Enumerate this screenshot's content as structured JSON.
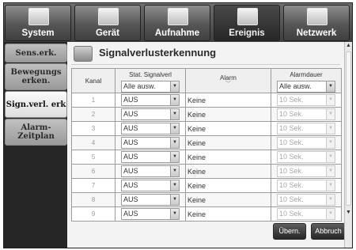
{
  "nav": {
    "tabs": [
      {
        "label": "System",
        "icon": "monitor-icon",
        "active": false
      },
      {
        "label": "Gerät",
        "icon": "camera-icon",
        "active": false
      },
      {
        "label": "Aufnahme",
        "icon": "rec-icon",
        "active": false
      },
      {
        "label": "Ereignis",
        "icon": "event-icon",
        "active": true
      },
      {
        "label": "Netzwerk",
        "icon": "network-icon",
        "active": false
      }
    ]
  },
  "sidebar": {
    "items": [
      {
        "label": "Sens.erk.",
        "active": false
      },
      {
        "label": "Bewegungs erken.",
        "active": false
      },
      {
        "label": "Sign.verl. erk",
        "active": true
      },
      {
        "label": "Alarm-Zeitplan",
        "active": false
      }
    ]
  },
  "page": {
    "title": "Signalverlusterkennung"
  },
  "table": {
    "headers": {
      "kanal": "Kanal",
      "status": "Stat. Signalverl",
      "alarm": "Alarm",
      "duration": "Alarmdauer"
    },
    "all_select_status": "Alle ausw.",
    "all_select_duration": "Alle ausw.",
    "rows": [
      {
        "kanal": "1",
        "status": "AUS",
        "alarm": "Keine",
        "duration": "10 Sek."
      },
      {
        "kanal": "2",
        "status": "AUS",
        "alarm": "Keine",
        "duration": "10 Sek."
      },
      {
        "kanal": "3",
        "status": "AUS",
        "alarm": "Keine",
        "duration": "10 Sek."
      },
      {
        "kanal": "4",
        "status": "AUS",
        "alarm": "Keine",
        "duration": "10 Sek."
      },
      {
        "kanal": "5",
        "status": "AUS",
        "alarm": "Keine",
        "duration": "10 Sek."
      },
      {
        "kanal": "6",
        "status": "AUS",
        "alarm": "Keine",
        "duration": "10 Sek."
      },
      {
        "kanal": "7",
        "status": "AUS",
        "alarm": "Keine",
        "duration": "10 Sek."
      },
      {
        "kanal": "8",
        "status": "AUS",
        "alarm": "Keine",
        "duration": "10 Sek."
      },
      {
        "kanal": "9",
        "status": "AUS",
        "alarm": "Keine",
        "duration": "10 Sek."
      }
    ]
  },
  "buttons": {
    "apply": "Übern.",
    "cancel": "Abbruch"
  }
}
